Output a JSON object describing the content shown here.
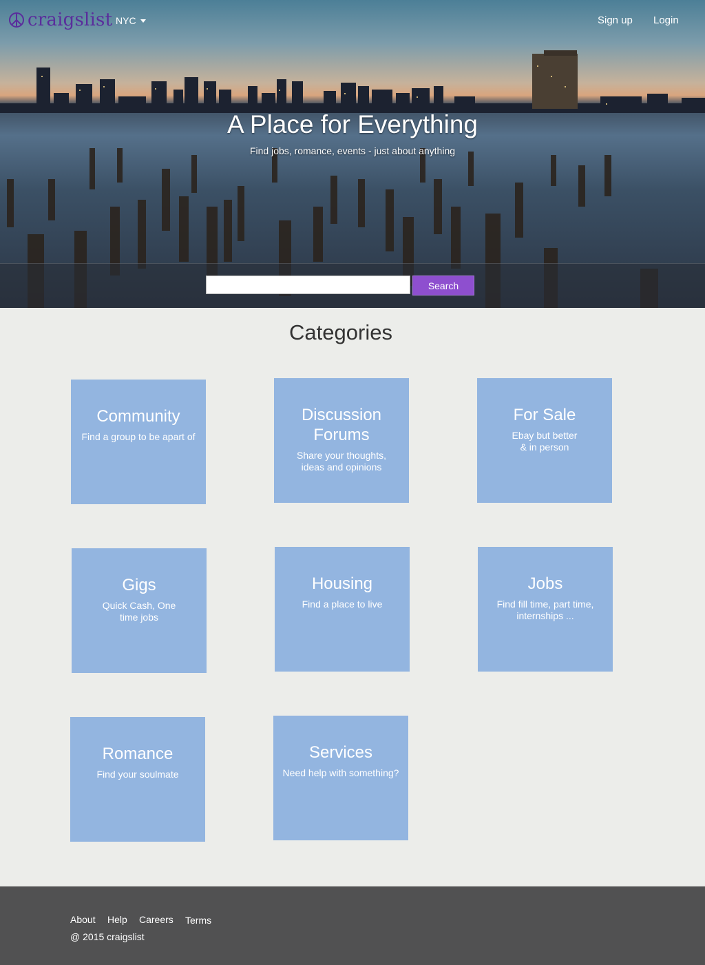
{
  "header": {
    "brand": "craigslist",
    "city": "NYC",
    "signup_label": "Sign up",
    "login_label": "Login"
  },
  "hero": {
    "title": "A Place for Everything",
    "subtitle": "Find jobs, romance, events - just about anything"
  },
  "search": {
    "value": "",
    "placeholder": "",
    "button_label": "Search"
  },
  "categories": {
    "heading": "Categories",
    "items": [
      {
        "title": "Community",
        "desc": "Find a group to be apart of"
      },
      {
        "title": "Discussion Forums",
        "desc": "Share your thoughts, ideas and opinions"
      },
      {
        "title": "For Sale",
        "desc": "Ebay but better & in person"
      },
      {
        "title": "Gigs",
        "desc": "Quick Cash, One time jobs"
      },
      {
        "title": "Housing",
        "desc": "Find a place to live"
      },
      {
        "title": "Jobs",
        "desc": "Find fill time, part time, internships ..."
      },
      {
        "title": "Romance",
        "desc": "Find your soulmate"
      },
      {
        "title": "Services",
        "desc": "Need help with something?"
      }
    ]
  },
  "footer": {
    "links": [
      "About",
      "Help",
      "Careers",
      "Terms"
    ],
    "copyright": "@ 2015 craigslist"
  },
  "colors": {
    "brand": "#5a2d9c",
    "accent": "#8e4fcf",
    "card": "#93b5e0",
    "background": "#ecedea",
    "footer": "#515152"
  }
}
